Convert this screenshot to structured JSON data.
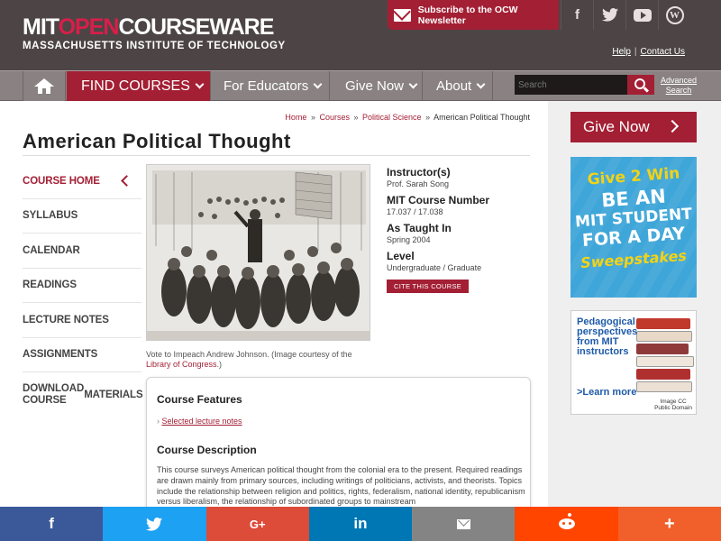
{
  "brand": {
    "logo_part1": "MIT",
    "logo_part2": "OPEN",
    "logo_part3": "COURSEWARE",
    "logo_sub": "MASSACHUSETTS INSTITUTE OF TECHNOLOGY",
    "accent_color": "#a31f34"
  },
  "header": {
    "newsletter_label": "Subscribe to the OCW Newsletter",
    "help_label": "Help",
    "contact_label": "Contact Us",
    "social_icons": [
      "facebook-icon",
      "twitter-icon",
      "youtube-icon",
      "wordpress-icon"
    ]
  },
  "nav": {
    "find_courses": "FIND COURSES",
    "for_educators": "For Educators",
    "give_now": "Give Now",
    "about": "About",
    "search_placeholder": "Search",
    "advanced_search_1": "Advanced",
    "advanced_search_2": "Search"
  },
  "breadcrumb": {
    "home": "Home",
    "courses": "Courses",
    "dept": "Political Science",
    "current": "American Political Thought",
    "sep": "»"
  },
  "page": {
    "title": "American Political Thought"
  },
  "leftnav": {
    "items": [
      "COURSE HOME",
      "SYLLABUS",
      "CALENDAR",
      "READINGS",
      "LECTURE NOTES",
      "ASSIGNMENTS",
      "DOWNLOAD COURSE",
      "MATERIALS"
    ]
  },
  "image": {
    "caption_text": "Vote to Impeach Andrew Johnson. (Image courtesy of the",
    "caption_link": "Library of Congress",
    "caption_end": ".)"
  },
  "course_info": {
    "instructor_label": "Instructor(s)",
    "instructor": "Prof. Sarah Song",
    "number_label": "MIT Course Number",
    "number": "17.037 / 17.038",
    "taught_label": "As Taught In",
    "taught": "Spring 2004",
    "level_label": "Level",
    "level": "Undergraduate / Graduate",
    "cite_label": "CITE THIS COURSE"
  },
  "features": {
    "features_heading": "Course Features",
    "feature_link": "Selected lecture notes",
    "description_heading": "Course Description",
    "description": "This course surveys American political thought from the colonial era to the present. Required readings are drawn mainly from primary sources, including writings of politicians, activists, and theorists. Topics include the relationship between religion and politics, rights, federalism, national identity, republicanism versus liberalism, the relationship of subordinated groups to mainstream"
  },
  "sidebar": {
    "give_now": "Give Now",
    "promo_line1": "Give 2 Win",
    "promo_line2": "BE AN",
    "promo_line3": "MIT STUDENT",
    "promo_line4": "FOR A DAY",
    "promo_line5": "Sweepstakes",
    "peda_title": "Pedagogical perspectives from MIT instructors",
    "peda_learn": ">Learn more",
    "peda_credit_1": "Image CC",
    "peda_credit_2": "Public Domain"
  },
  "share": {
    "facebook": "f",
    "twitter": "t",
    "googleplus": "G+",
    "linkedin": "in",
    "more": "+"
  }
}
